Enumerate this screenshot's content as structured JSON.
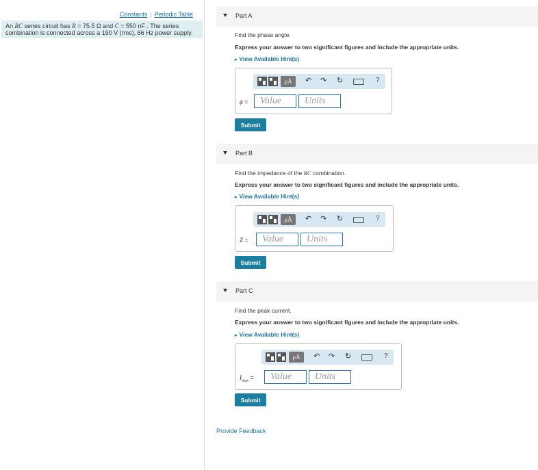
{
  "sidebar": {
    "constants_link": "Constants",
    "separator": "|",
    "periodic_link": "Periodic Table",
    "problem": {
      "t1": "An ",
      "rc": "RC",
      "t2": " series circuit has ",
      "r": "R",
      "t3": " = 75.5 Ω and ",
      "c": "C",
      "t4": " = 550 nF . The series combination is connected across a 190 V (rms), 66 Hz power supply."
    }
  },
  "toolbar": {
    "units_label": "μÅ",
    "help": "?"
  },
  "common": {
    "express": "Express your answer to two significant figures and include the appropriate units.",
    "hint": "View Available Hint(s)",
    "value_placeholder": "Value",
    "units_placeholder": "Units",
    "submit": "Submit"
  },
  "parts": [
    {
      "title": "Part A",
      "question": "Find the phase angle.",
      "var": "ϕ",
      "var_suffix": " ="
    },
    {
      "title": "Part B",
      "question_pre": "Find the impedance of the ",
      "question_var": "RC",
      "question_post": " combination.",
      "var": "Z",
      "var_suffix": " ="
    },
    {
      "title": "Part C",
      "question": "Find the peak current.",
      "var": "I",
      "var_sub": "max",
      "var_suffix": " ="
    }
  ],
  "feedback": "Provide Feedback"
}
